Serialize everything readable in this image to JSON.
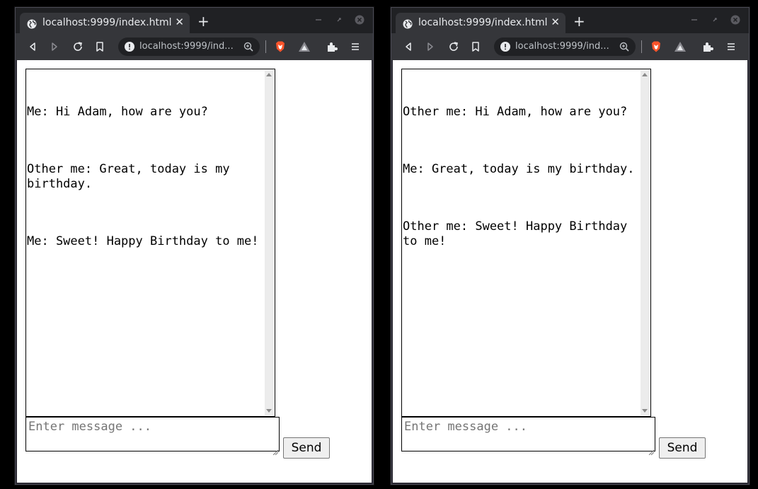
{
  "windows": [
    {
      "tab_title": "localhost:9999/index.html",
      "tab_close": "✕",
      "new_tab": "+",
      "address": "localhost:9999/ind...",
      "chat_lines": [
        "Me: Hi Adam, how are you?",
        "Other me: Great, today is my birthday.",
        "Me: Sweet! Happy Birthday to me!"
      ],
      "input_placeholder": "Enter message ...",
      "send_label": "Send"
    },
    {
      "tab_title": "localhost:9999/index.html",
      "tab_close": "✕",
      "new_tab": "+",
      "address": "localhost:9999/ind...",
      "chat_lines": [
        "Other me: Hi Adam, how are you?",
        "Me: Great, today is my birthday.",
        "Other me: Sweet! Happy Birthday to me!"
      ],
      "input_placeholder": "Enter message ...",
      "send_label": "Send"
    }
  ],
  "colors": {
    "titlebar": "#202124",
    "toolbar": "#35363a",
    "omnibox": "#202124",
    "brave_orange": "#fb542b"
  }
}
